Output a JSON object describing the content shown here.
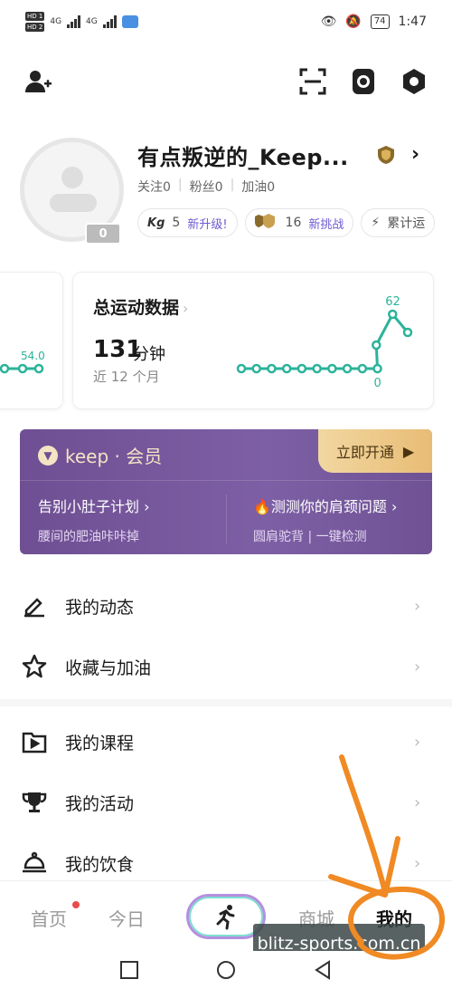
{
  "status_bar": {
    "hd1": "HD 1",
    "hd2": "HD 2",
    "net1": "4G",
    "net2": "4G",
    "battery": "74",
    "time": "1:47"
  },
  "top_icons": [
    "add-friend-icon",
    "scan-icon",
    "watch-icon",
    "settings-icon"
  ],
  "profile": {
    "name": "有点叛逆的_Keep...",
    "level_badge": "0",
    "stats": [
      {
        "label": "关注",
        "value": "0"
      },
      {
        "label": "粉丝",
        "value": "0"
      },
      {
        "label": "加油",
        "value": "0"
      }
    ],
    "chips": [
      {
        "prefix": "Kg",
        "value": "5",
        "tag": "新升级!"
      },
      {
        "value": "16",
        "tag": "新挑战"
      },
      {
        "text": "累计运"
      }
    ]
  },
  "cards": {
    "left_value": "54.0",
    "main": {
      "title": "总运动数据",
      "value": "131",
      "unit": "分钟",
      "subtitle": "近 12 个月",
      "peak_label": "62",
      "zero_label": "0"
    }
  },
  "chart_data": {
    "type": "line",
    "x": [
      1,
      2,
      3,
      4,
      5,
      6,
      7,
      8,
      9,
      10,
      11,
      12
    ],
    "values": [
      0,
      0,
      0,
      0,
      0,
      0,
      0,
      0,
      0,
      0,
      62,
      0
    ],
    "annotations": [
      "62",
      "0"
    ],
    "color": "#2bb39a"
  },
  "vip": {
    "brand": "keep · 会员",
    "button": "立即开通",
    "left_title": "告别小肚子计划 ›",
    "left_sub": "腰间的肥油咔咔掉",
    "right_title": "🔥测测你的肩颈问题 ›",
    "right_sub": "圆肩驼背 | 一键检测"
  },
  "menu": [
    {
      "label": "我的动态",
      "icon": "edit-icon"
    },
    {
      "label": "收藏与加油",
      "icon": "star-icon"
    },
    {
      "label": "我的课程",
      "icon": "play-folder-icon"
    },
    {
      "label": "我的活动",
      "icon": "trophy-icon"
    },
    {
      "label": "我的饮食",
      "icon": "food-cloche-icon"
    }
  ],
  "tabs": {
    "home": "首页",
    "today": "今日",
    "mall": "商城",
    "mine": "我的"
  },
  "watermark": "blitz-sports.com.cn",
  "colors": {
    "accent": "#2bb39a",
    "vip_purple": "#6f4f93",
    "vip_gold": "#e8bc75",
    "annotation_orange": "#f08a24"
  }
}
